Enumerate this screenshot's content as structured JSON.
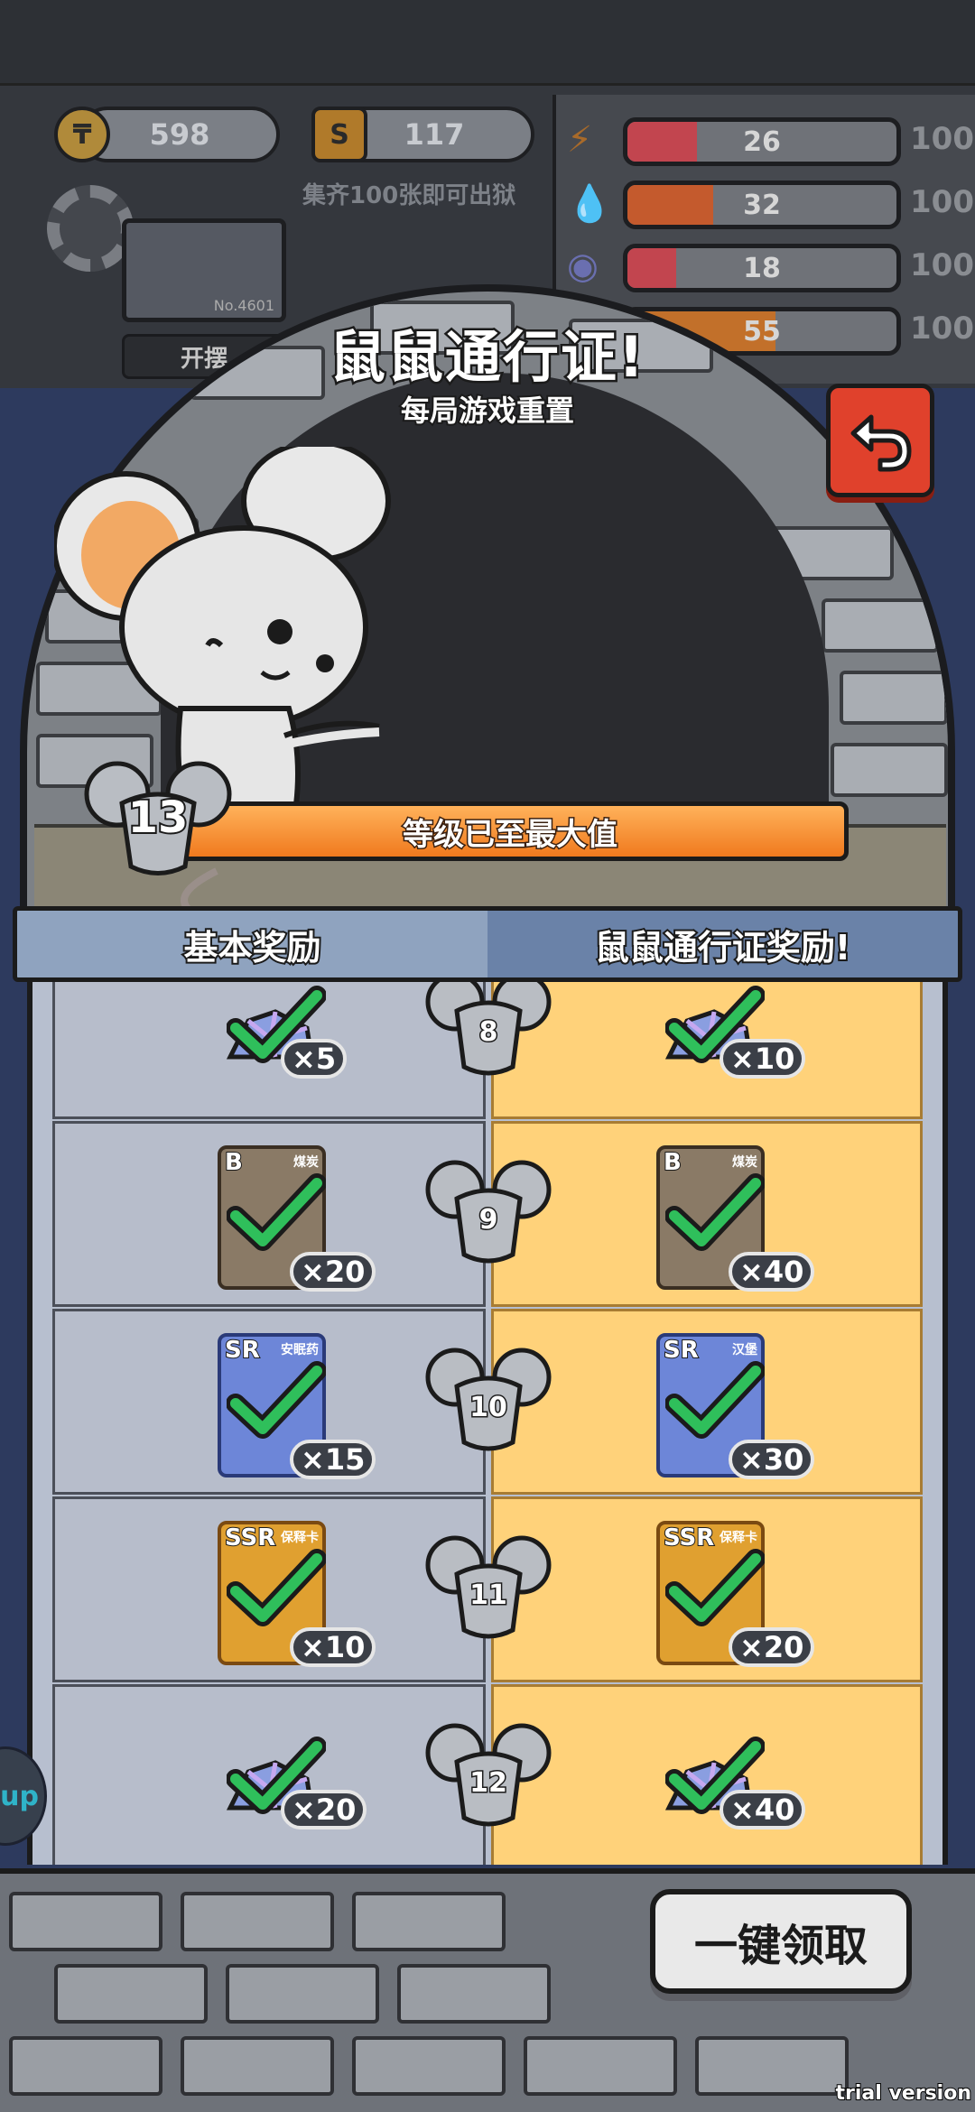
{
  "hud": {
    "coins": "598",
    "shards": "117",
    "collect_hint": "集齐100张即可出狱",
    "player_no": "No.4601",
    "idle_button": "开摆",
    "stats": [
      {
        "icon": "lightning-icon",
        "value": "26",
        "max": "100",
        "color": "#c2454f"
      },
      {
        "icon": "water-drop-icon",
        "value": "32",
        "max": "100",
        "color": "#c45a2d"
      },
      {
        "icon": "brain-icon",
        "value": "18",
        "max": "100",
        "color": "#c2454f"
      },
      {
        "icon": "stat-icon",
        "value": "55",
        "max": "100",
        "color": "#c2702a"
      }
    ]
  },
  "pass": {
    "title": "鼠鼠通行证!",
    "subtitle": "每局游戏重置",
    "level": "13",
    "level_status": "等级已至最大值",
    "tab_basic": "基本奖励",
    "tab_pass": "鼠鼠通行证奖励!",
    "claim_all": "一键领取"
  },
  "rows": [
    {
      "level": "8",
      "basic": {
        "type": "gem",
        "qty": "×5"
      },
      "pass": {
        "type": "gem",
        "qty": "×10"
      }
    },
    {
      "level": "9",
      "basic": {
        "type": "card-b",
        "rarity": "B",
        "name": "煤炭",
        "qty": "×20"
      },
      "pass": {
        "type": "card-b",
        "rarity": "B",
        "name": "煤炭",
        "qty": "×40"
      }
    },
    {
      "level": "10",
      "basic": {
        "type": "card-sr",
        "rarity": "SR",
        "name": "安眠药",
        "qty": "×15"
      },
      "pass": {
        "type": "card-sr",
        "rarity": "SR",
        "name": "汉堡",
        "qty": "×30"
      }
    },
    {
      "level": "11",
      "basic": {
        "type": "card-ssr",
        "rarity": "SSR",
        "name": "保释卡",
        "qty": "×10"
      },
      "pass": {
        "type": "card-ssr",
        "rarity": "SSR",
        "name": "保释卡",
        "qty": "×20"
      }
    },
    {
      "level": "12",
      "basic": {
        "type": "gem",
        "qty": "×20"
      },
      "pass": {
        "type": "gem",
        "qty": "×40"
      }
    }
  ],
  "side_tab": "up",
  "watermark": "trial version"
}
